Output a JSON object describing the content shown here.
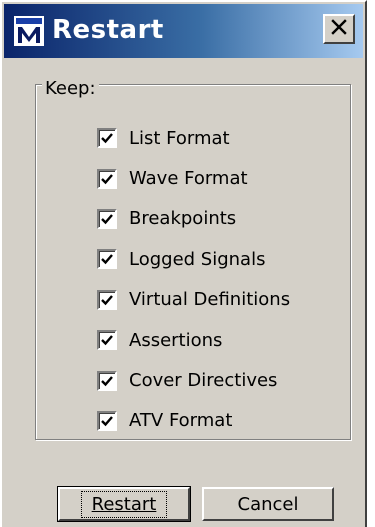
{
  "window": {
    "title": "Restart",
    "icon": "modelsim-m-icon",
    "close_icon": "close-icon"
  },
  "group": {
    "legend": "Keep:",
    "options": [
      {
        "label": "List Format",
        "checked": true
      },
      {
        "label": "Wave Format",
        "checked": true
      },
      {
        "label": "Breakpoints",
        "checked": true
      },
      {
        "label": "Logged Signals",
        "checked": true
      },
      {
        "label": "Virtual Definitions",
        "checked": true
      },
      {
        "label": "Assertions",
        "checked": true
      },
      {
        "label": "Cover Directives",
        "checked": true
      },
      {
        "label": "ATV Format",
        "checked": true
      }
    ]
  },
  "buttons": {
    "restart_label": "Restart",
    "cancel_label": "Cancel"
  },
  "colors": {
    "face": "#d4d0c8",
    "title_start": "#0a246a",
    "title_end": "#a6caf0"
  }
}
